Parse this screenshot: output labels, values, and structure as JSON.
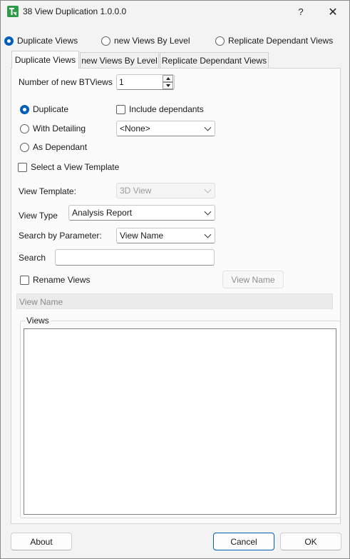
{
  "window": {
    "title": "38 View Duplication 1.0.0.0",
    "help_glyph": "?",
    "close_glyph": "✕"
  },
  "mode_radios": [
    {
      "label": "Duplicate Views",
      "selected": true
    },
    {
      "label": "new Views By Level",
      "selected": false
    },
    {
      "label": "Replicate Dependant Views",
      "selected": false
    }
  ],
  "tabs": [
    {
      "label": "Duplicate Views",
      "active": true
    },
    {
      "label": "new Views By Level",
      "active": false
    },
    {
      "label": "Replicate Dependant Views",
      "active": false
    }
  ],
  "form": {
    "number_label": "Number of new BTViews",
    "number_value": "1",
    "duplicate_options": [
      {
        "label": "Duplicate",
        "selected": true
      },
      {
        "label": "With Detailing",
        "selected": false
      },
      {
        "label": "As Dependant",
        "selected": false
      }
    ],
    "include_dependants_label": "Include dependants",
    "dependants_combo_value": "<None>",
    "select_template_label": "Select a View Template",
    "view_template_label": "View Template:",
    "view_template_value": "3D View",
    "view_type_label": "View Type",
    "view_type_value": "Analysis Report",
    "search_param_label": "Search by Parameter:",
    "search_param_value": "View Name",
    "search_label": "Search",
    "search_value": "",
    "rename_label": "Rename Views",
    "rename_button": "View Name",
    "view_name_placeholder": "View Name",
    "views_group_label": "Views"
  },
  "footer": {
    "about": "About",
    "cancel": "Cancel",
    "ok": "OK"
  },
  "colors": {
    "accent": "#005fb8",
    "window_bg": "#f3f3f3",
    "icon_green": "#2e9b48"
  }
}
